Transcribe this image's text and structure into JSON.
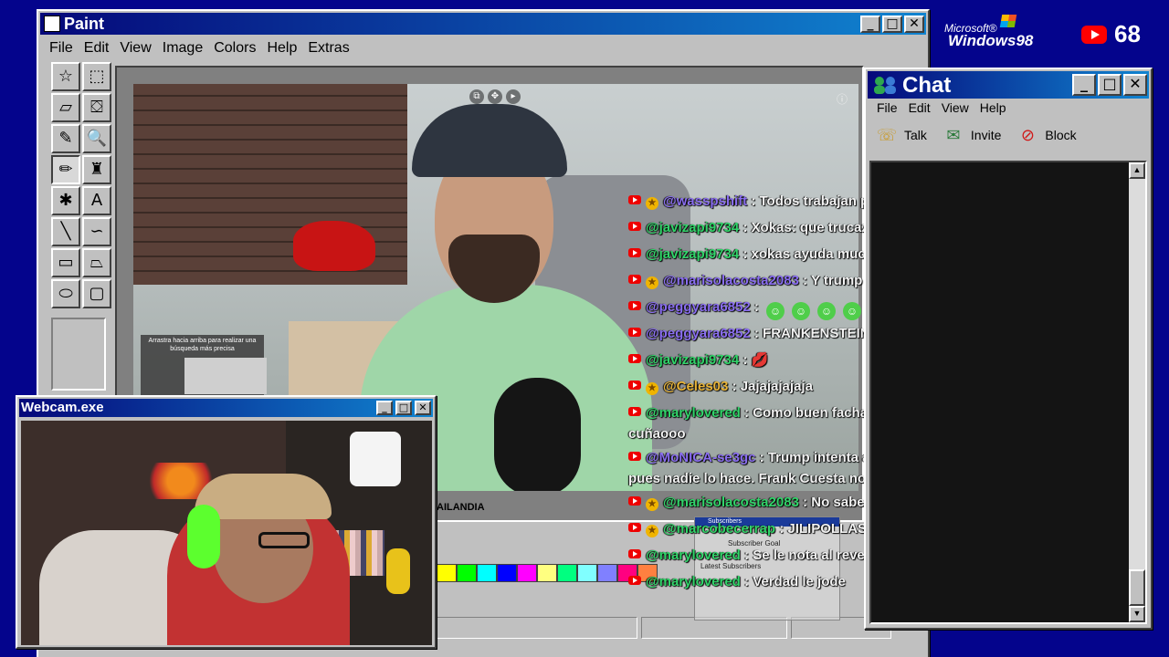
{
  "paint": {
    "title": "Paint",
    "menu": [
      "File",
      "Edit",
      "View",
      "Image",
      "Colors",
      "Help",
      "Extras"
    ],
    "tools": [
      {
        "name": "free-select-icon",
        "glyph": "☆"
      },
      {
        "name": "rect-select-icon",
        "glyph": "⬚"
      },
      {
        "name": "eraser-icon",
        "glyph": "▱"
      },
      {
        "name": "fill-icon",
        "glyph": "⛋"
      },
      {
        "name": "color-picker-icon",
        "glyph": "✎"
      },
      {
        "name": "magnifier-icon",
        "glyph": "🔍"
      },
      {
        "name": "pencil-icon",
        "glyph": "✏"
      },
      {
        "name": "brush-icon",
        "glyph": "♜"
      },
      {
        "name": "airbrush-icon",
        "glyph": "✱"
      },
      {
        "name": "text-icon",
        "glyph": "A"
      },
      {
        "name": "line-icon",
        "glyph": "╲"
      },
      {
        "name": "curve-icon",
        "glyph": "∽"
      },
      {
        "name": "rectangle-icon",
        "glyph": "▭"
      },
      {
        "name": "polygon-icon",
        "glyph": "⏢"
      },
      {
        "name": "ellipse-icon",
        "glyph": "⬭"
      },
      {
        "name": "rounded-rect-icon",
        "glyph": "▢"
      }
    ],
    "palette": [
      "#ffff00",
      "#00ff00",
      "#00ffff",
      "#0000ff",
      "#ff00ff",
      "#ffff80",
      "#00ff80",
      "#80ffff",
      "#8080ff",
      "#ff0080",
      "#ff8040"
    ],
    "bg_text": "AILANDIA"
  },
  "video": {
    "pip_caption": "Arrastra hacia arriba para realizar una búsqueda más precisa"
  },
  "subs_mini": {
    "title": "Subscribers",
    "line1": "Subscriber Goal",
    "line2": "Latest Subscribers"
  },
  "chat_overlay": [
    {
      "badge": true,
      "user": "@wasspshift",
      "color": "purple",
      "text": "Todos trabajan para algo bueno, sí claro JAJAJA"
    },
    {
      "badge": false,
      "user": "@javizapi9734",
      "color": "green",
      "text": "Xokas: que trucazo ligar con chicas borrachas 🤢"
    },
    {
      "badge": false,
      "user": "@javizapi9734",
      "color": "green",
      "text": "xokas ayuda mucho"
    },
    {
      "badge": true,
      "user": "@marisolacosta2083",
      "color": "purple",
      "text": "Y trump tb hace cosas buenas para el"
    },
    {
      "badge": false,
      "user": "@peggyara6852",
      "color": "purple",
      "text": "",
      "emotes": 4
    },
    {
      "badge": false,
      "user": "@peggyara6852",
      "color": "purple",
      "text": "FRANKENSTEIN POR FAVOR 😹 😂 😹 😂"
    },
    {
      "badge": false,
      "user": "@javizapi9734",
      "color": "green",
      "text": "💋"
    },
    {
      "badge": true,
      "user": "@Celes03",
      "color": "orange",
      "text": "Jajajajajaja"
    },
    {
      "badge": false,
      "user": "@marylovered",
      "color": "green",
      "text": "Como buen facha encantando de estar con esa basura el cuñaooo",
      "wrap": true
    },
    {
      "badge": false,
      "user": "@MoNICA-se3gc",
      "color": "purple",
      "text": "Trump intenta ayudar a Venezuela aunque sea un narciso pues nadie lo hace. Frank Cuesta no entiende por qué está ahí",
      "wrap": true
    },
    {
      "badge": true,
      "user": "@marisolacosta2083",
      "color": "green",
      "text": "No sabe que disparate decir jaajajajaja"
    },
    {
      "badge": true,
      "user": "@marcobecerrap",
      "color": "green",
      "text": "JILIPOLLAS CALIDAD TOP!! 🏆"
    },
    {
      "badge": false,
      "user": "@marylovered",
      "color": "green",
      "text": "Se le nota al reventado que la"
    },
    {
      "badge": false,
      "user": "@marylovered",
      "color": "green",
      "text": "Verdad le jode"
    }
  ],
  "webcam": {
    "title": "Webcam.exe"
  },
  "chat": {
    "title": "Chat",
    "menu": [
      "File",
      "Edit",
      "View",
      "Help"
    ],
    "tools": [
      {
        "name": "talk",
        "label": "Talk",
        "icon": "talk-icon",
        "glyph": "☏"
      },
      {
        "name": "invite",
        "label": "Invite",
        "icon": "invite-icon",
        "glyph": "✉"
      },
      {
        "name": "block",
        "label": "Block",
        "icon": "block-icon",
        "glyph": "⊘"
      }
    ]
  },
  "brand": {
    "microsoft": "Microsoft®",
    "windows": "Windows98",
    "youtube_count": "68"
  }
}
